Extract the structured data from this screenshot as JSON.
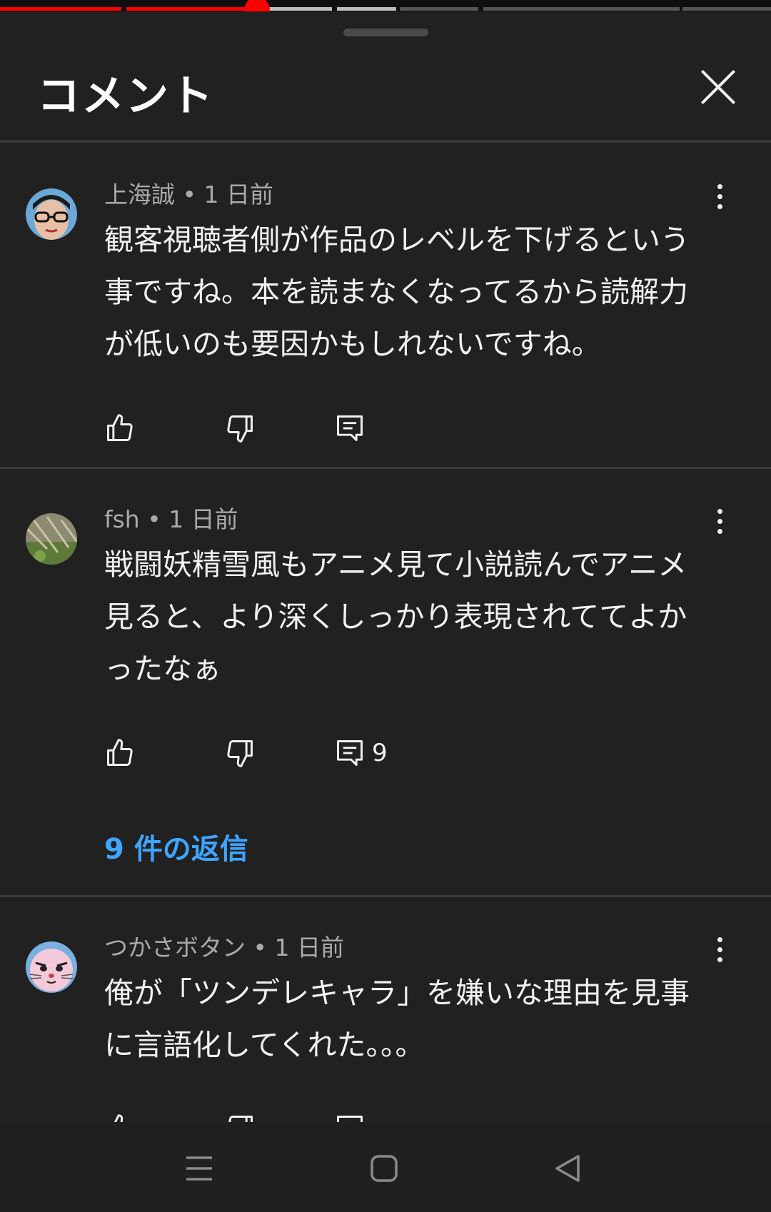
{
  "sheet": {
    "title": "コメント"
  },
  "comments": [
    {
      "author": "上海誠",
      "time": "1 日前",
      "text": "観客視聴者側が作品のレベルを下げるという事ですね。本を読まなくなってるから読解力が低いのも要因かもしれないですね。",
      "reply_count": ""
    },
    {
      "author": "fsh",
      "time": "1 日前",
      "text": "戦闘妖精雪風もアニメ見て小説読んでアニメ見ると、より深くしっかり表現されててよかったなぁ",
      "reply_count": "9",
      "replies_link": "9 件の返信"
    },
    {
      "author": "つかさボタン",
      "time": "1 日前",
      "text": "俺が「ツンデレキャラ」を嫌いな理由を見事に言語化してくれた。。。",
      "reply_count": ""
    }
  ],
  "separator": " • ",
  "colors": {
    "background": "#212121",
    "text": "#f1f1f1",
    "meta": "#aaaaaa",
    "link": "#3ea6ff",
    "progress": "#ff0000"
  },
  "icons": [
    "close-icon",
    "more-vert-icon",
    "thumbs-up-icon",
    "thumbs-down-icon",
    "comment-icon",
    "menu-icon",
    "home-icon",
    "back-icon"
  ]
}
